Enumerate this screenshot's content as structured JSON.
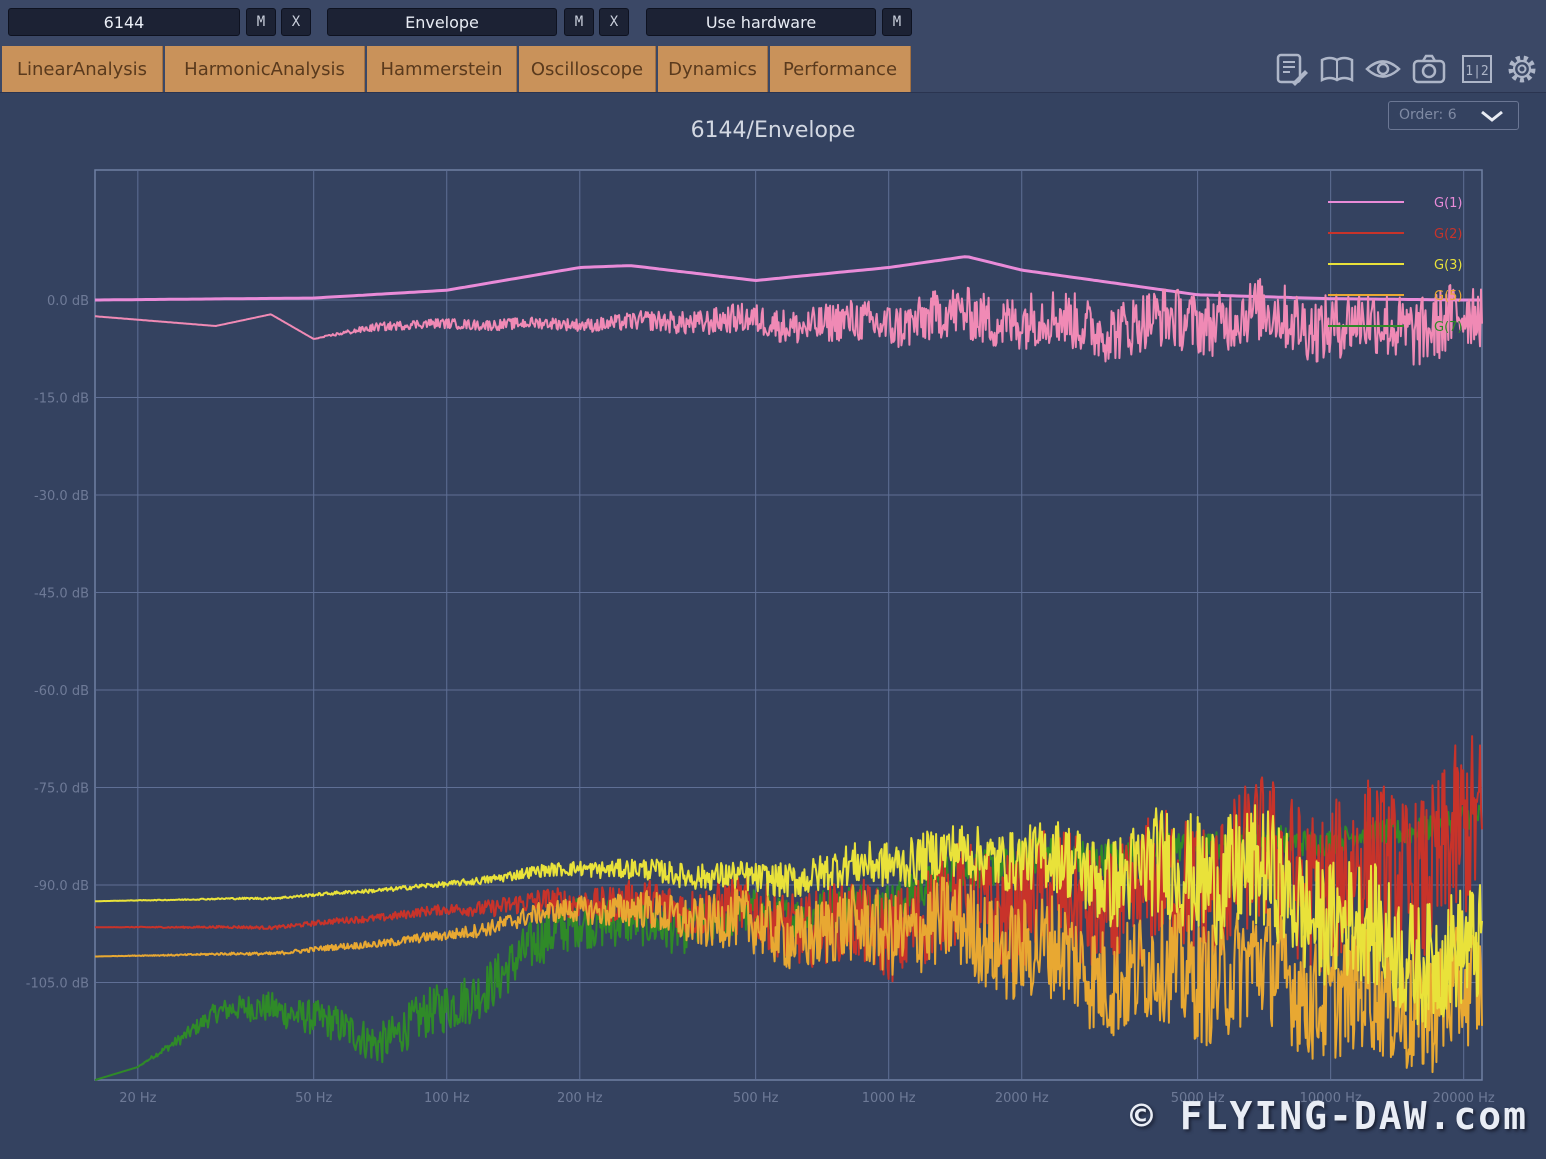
{
  "topbar": {
    "device_field": "6144",
    "mode_field": "Envelope",
    "hardware_field": "Use hardware",
    "m_label": "M",
    "x_label": "X"
  },
  "tabs": [
    "LinearAnalysis",
    "HarmonicAnalysis",
    "Hammerstein",
    "Oscilloscope",
    "Dynamics",
    "Performance"
  ],
  "toolbar_icons": [
    "notes-icon",
    "book-icon",
    "eye-icon",
    "camera-icon",
    "split-view-icon",
    "gear-icon"
  ],
  "order_select": {
    "value": "Order: 6"
  },
  "watermark": "© FLYING-DAW.com",
  "colors": {
    "tab_bg": "#c9925a",
    "plot_bg": "#344260",
    "G1": "#e98bd8",
    "G1_measured": "#f08ab5",
    "G2": "#c8332a",
    "G3": "#e9e23a",
    "G4": "#2f8a28",
    "G5": "#e8a832"
  },
  "chart_data": {
    "type": "line",
    "title": "6144/Envelope",
    "x_scale": "log",
    "xlim": [
      16,
      22000
    ],
    "ylim": [
      -120,
      20
    ],
    "x_tick_labels": [
      "20 Hz",
      "50 Hz",
      "100 Hz",
      "200 Hz",
      "500 Hz",
      "1000 Hz",
      "2000 Hz",
      "5000 Hz",
      "10000 Hz",
      "20000 Hz"
    ],
    "x_ticks": [
      20,
      50,
      100,
      200,
      500,
      1000,
      2000,
      5000,
      10000,
      20000
    ],
    "y_tick_labels": [
      "0.0 dB",
      "-15.0 dB",
      "-30.0 dB",
      "-45.0 dB",
      "-60.0 dB",
      "-75.0 dB",
      "-90.0 dB",
      "-105.0 dB"
    ],
    "y_ticks": [
      0,
      -15,
      -30,
      -45,
      -60,
      -75,
      -90,
      -105
    ],
    "legend_position": "top-right",
    "legend": [
      "G(1)",
      "G(2)",
      "G(3)",
      "G(5)",
      "G(7)"
    ],
    "series": [
      {
        "name": "G(1)",
        "kind": "smooth",
        "x": [
          16,
          50,
          100,
          200,
          260,
          500,
          1000,
          1500,
          2000,
          5000,
          10000,
          20000
        ],
        "values": [
          0,
          0.3,
          1.5,
          5.0,
          5.3,
          3.0,
          5.0,
          6.7,
          4.6,
          0.8,
          0.2,
          0
        ]
      },
      {
        "name": "",
        "kind": "noisy",
        "x": [
          16,
          30,
          40,
          50,
          70,
          200,
          500,
          1000,
          2000,
          5000,
          10000,
          20000
        ],
        "values": [
          -2.5,
          -4.0,
          -2.2,
          -6.0,
          -4.0,
          -3.5,
          -3.5,
          -3.2,
          -3.2,
          -3.3,
          -3.3,
          -3.3
        ],
        "noise": [
          0,
          0,
          0,
          0,
          0.8,
          1.2,
          3.0,
          4.5,
          5.5,
          6.0,
          6.5,
          7.0
        ]
      },
      {
        "name": "G(3)",
        "kind": "noisy",
        "x": [
          16,
          40,
          100,
          200,
          500,
          1000,
          2000,
          5000,
          10000,
          20000
        ],
        "values": [
          -92.5,
          -92.0,
          -90.0,
          -87.0,
          -89.5,
          -86.0,
          -86.0,
          -88.0,
          -94.0,
          -102.0
        ],
        "noise": [
          0,
          0.2,
          0.5,
          1.5,
          3.0,
          4.5,
          6.0,
          12.0,
          12.0,
          12.0
        ]
      },
      {
        "name": "G(2)",
        "kind": "noisy",
        "x": [
          16,
          40,
          100,
          200,
          500,
          1000,
          2000,
          5000,
          10000,
          20000
        ],
        "values": [
          -96.5,
          -96.5,
          -94.0,
          -92.0,
          -95.0,
          -96.0,
          -93.0,
          -90.0,
          -88.0,
          -85.0
        ],
        "noise": [
          0,
          0.3,
          1.0,
          3.0,
          6.0,
          9.0,
          12.0,
          14.0,
          16.0,
          18.0
        ]
      },
      {
        "name": "G(5)",
        "kind": "noisy",
        "x": [
          16,
          40,
          100,
          200,
          500,
          1000,
          2000,
          5000,
          10000,
          20000
        ],
        "values": [
          -101.0,
          -100.5,
          -98.0,
          -93.0,
          -97.0,
          -96.0,
          -100.0,
          -104.0,
          -106.0,
          -108.0
        ],
        "noise": [
          0,
          0.3,
          1.0,
          2.5,
          6.0,
          8.0,
          10.0,
          12.0,
          12.0,
          12.0
        ]
      },
      {
        "name": "G(7)",
        "kind": "noisy",
        "x": [
          16,
          20,
          30,
          40,
          70,
          100,
          200,
          300,
          500,
          1000,
          2000,
          5000,
          10000,
          20000
        ],
        "values": [
          -120,
          -118,
          -110,
          -108,
          -114,
          -110,
          -94,
          -97,
          -95,
          -92,
          -86,
          -84,
          -83,
          -80
        ],
        "noise": [
          0,
          0,
          2.0,
          3.0,
          4.0,
          5.0,
          5.0,
          5.0,
          4.5,
          4.0,
          3.5,
          3.0,
          2.5,
          2.5
        ]
      }
    ]
  }
}
